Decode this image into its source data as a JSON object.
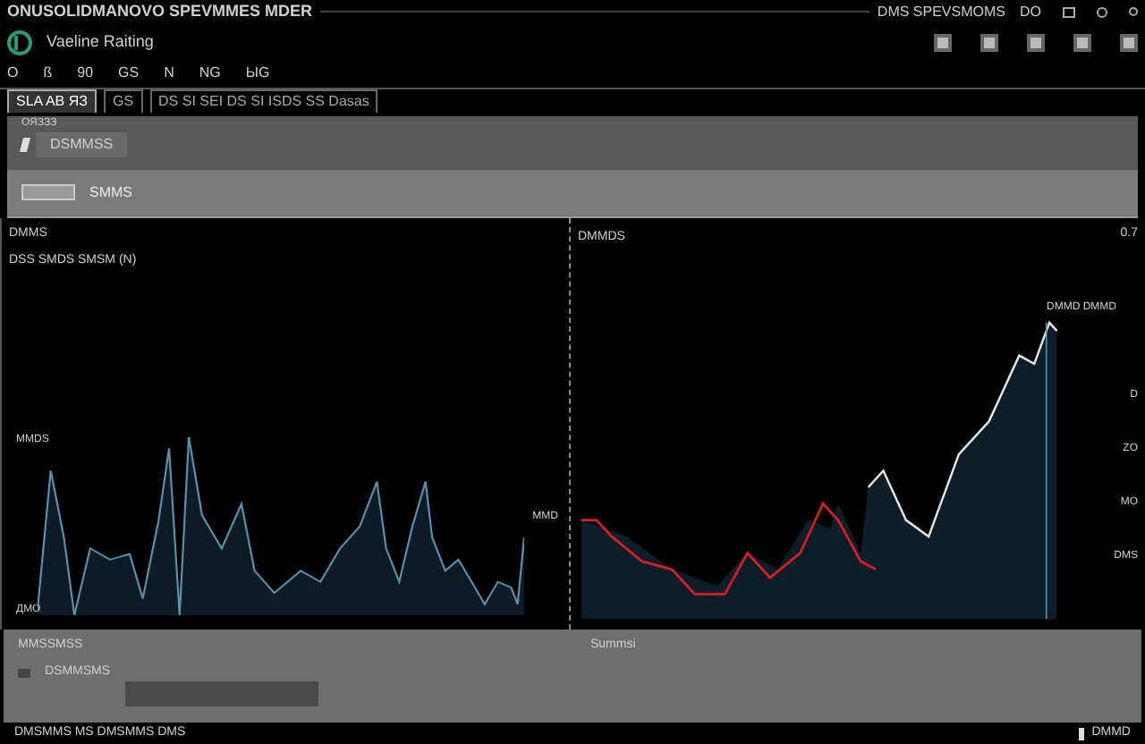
{
  "window": {
    "title": "ONUSOLIDMANOVO SPEVMMES MDER",
    "status_text": "DMS SPEVSMOMS",
    "badge": "DO"
  },
  "app": {
    "name": "Vaeline Raiting"
  },
  "menu": [
    "O",
    "ß",
    "90",
    "GS",
    "N",
    "NG",
    "ЫG"
  ],
  "tabs": [
    {
      "label": "SLA AB ЯЗ",
      "selected": true
    },
    {
      "label": "GS",
      "selected": false
    },
    {
      "label": "DS SI SEI DS SI ISDS SS Dasas",
      "selected": false
    }
  ],
  "panel": {
    "caption": "ОЯЗЗЗ",
    "tool_label": "DSMMSS",
    "row_label": "SMMS"
  },
  "left_chart": {
    "title": "DMMS",
    "subtitle": "DSS SMDS SMSM (N)",
    "axis_labels": [
      "MMDS",
      "ДМО",
      "MMD"
    ]
  },
  "right_chart": {
    "title": "DMMDS",
    "corner": "0.7",
    "annotation": "DMMD DMMD",
    "axis_labels": [
      "D",
      "ZO",
      "MO",
      "DMS"
    ]
  },
  "bottom_panel": {
    "caption": "MMSSMSS",
    "item": "DSMMSMS",
    "right_caption": "Summsi"
  },
  "status_bar": {
    "text": "DMSMMS MS DMSMMS DMS",
    "right": "DMMD"
  }
}
